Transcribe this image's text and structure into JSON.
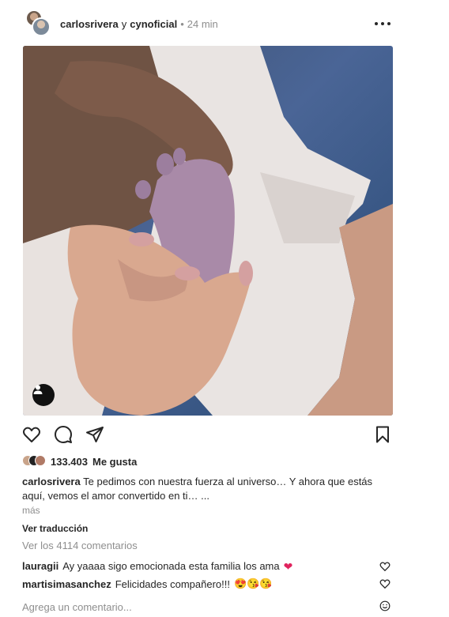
{
  "header": {
    "author": "carlosrivera",
    "connector": "y",
    "coauthor": "cynoficial",
    "separator": "•",
    "time": "24 min"
  },
  "post": {
    "likes_count": "133.403",
    "likes_label": "Me gusta",
    "caption_user": "carlosrivera",
    "caption_text": "Te pedimos con nuestra fuerza al universo… Y ahora que estás aquí, vemos el amor convertido en ti… ...",
    "more": "más",
    "translate": "Ver traducción",
    "view_comments": "Ver los 4114 comentarios"
  },
  "comments": [
    {
      "user": "lauragii",
      "text": "Ay yaaaa sigo emocionada esta familia los ama",
      "emoji": "❤"
    },
    {
      "user": "martisimasanchez",
      "text": "Felicidades compañero!!!",
      "emoji": "😍😘😘"
    }
  ],
  "add_comment": {
    "placeholder": "Agrega un comentario..."
  },
  "colors": {
    "heart_red": "#e0245e",
    "muted": "#8e8e8e",
    "text": "#262626"
  }
}
